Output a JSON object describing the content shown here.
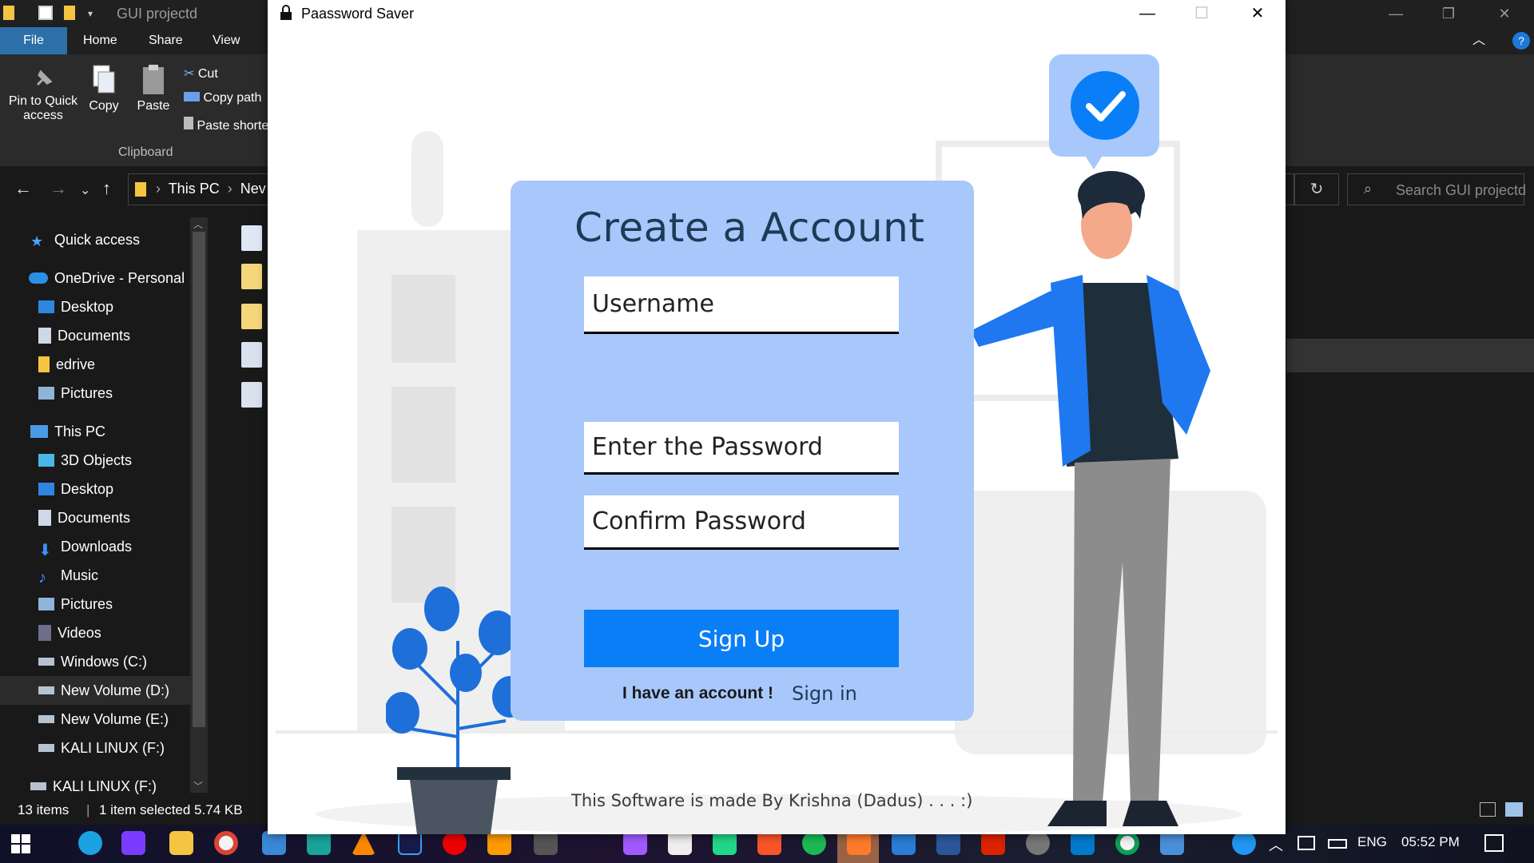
{
  "explorer": {
    "title": "GUI projectd",
    "ribbon_tabs": [
      "File",
      "Home",
      "Share",
      "View"
    ],
    "ribbon": {
      "pin_label_1": "Pin to Quick",
      "pin_label_2": "access",
      "copy_label": "Copy",
      "paste_label": "Paste",
      "cut_label": "Cut",
      "copy_path_label": "Copy path",
      "paste_shortcut_label": "Paste shorte",
      "group_label": "Clipboard"
    },
    "breadcrumb": [
      "This PC",
      "Nev"
    ],
    "search_placeholder": "Search GUI projectd",
    "nav_items": [
      {
        "label": "Quick access",
        "icon": "star-icon"
      },
      {
        "label": "OneDrive - Personal",
        "icon": "cloud-icon"
      },
      {
        "label": "Desktop",
        "icon": "desktop-icon"
      },
      {
        "label": "Documents",
        "icon": "documents-icon"
      },
      {
        "label": "edrive",
        "icon": "folder-icon"
      },
      {
        "label": "Pictures",
        "icon": "pictures-icon"
      },
      {
        "label": "This PC",
        "icon": "computer-icon"
      },
      {
        "label": "3D Objects",
        "icon": "cube-icon"
      },
      {
        "label": "Desktop",
        "icon": "desktop-icon"
      },
      {
        "label": "Documents",
        "icon": "documents-icon"
      },
      {
        "label": "Downloads",
        "icon": "download-icon"
      },
      {
        "label": "Music",
        "icon": "music-icon"
      },
      {
        "label": "Pictures",
        "icon": "pictures-icon"
      },
      {
        "label": "Videos",
        "icon": "videos-icon"
      },
      {
        "label": "Windows (C:)",
        "icon": "drive-icon"
      },
      {
        "label": "New Volume (D:)",
        "icon": "drive-icon"
      },
      {
        "label": "New Volume (E:)",
        "icon": "drive-icon"
      },
      {
        "label": "KALI LINUX (F:)",
        "icon": "drive-icon"
      },
      {
        "label": "KALI LINUX (F:)",
        "icon": "drive-icon"
      }
    ],
    "status_count": "13 items",
    "status_selected": "1 item selected  5.74 KB"
  },
  "taskbar": {
    "language": "ENG",
    "time": "05:52 PM"
  },
  "app": {
    "title": "Paassword Saver",
    "heading": "Create a Account",
    "username_placeholder": "Username",
    "password_placeholder": "Enter the Password",
    "confirm_placeholder": "Confirm Password",
    "signup_label": "Sign Up",
    "have_account_text": "I have an account !",
    "signin_label": "Sign in",
    "credit": "This Software is made By Krishna (Dadus) . . . :)"
  },
  "colors": {
    "card": "#a8c8fb",
    "button": "#0a7ef6",
    "heading": "#1e3a56",
    "check_badge": "#0a7ef6"
  }
}
